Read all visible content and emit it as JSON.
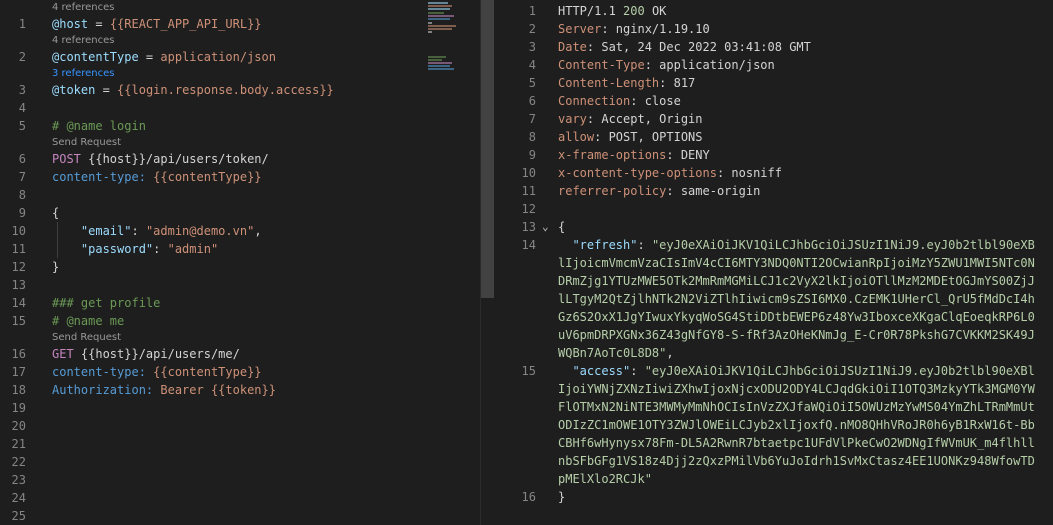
{
  "editor": {
    "lines": [
      {
        "n": "1",
        "lens": "4 references",
        "tokens": [
          [
            "var",
            "@host"
          ],
          [
            "def",
            " = "
          ],
          [
            "str",
            "{{REACT_APP_API_URL}}"
          ]
        ]
      },
      {
        "n": "2",
        "lens": "4 references",
        "tokens": [
          [
            "var",
            "@contentType"
          ],
          [
            "def",
            " = "
          ],
          [
            "str",
            "application/json"
          ]
        ]
      },
      {
        "n": "3",
        "lens": "3 references",
        "lensColor": "link",
        "tokens": [
          [
            "var",
            "@token"
          ],
          [
            "def",
            " = "
          ],
          [
            "str",
            "{{login.response.body.access}}"
          ]
        ]
      },
      {
        "n": "4",
        "tokens": []
      },
      {
        "n": "5",
        "tokens": [
          [
            "cmt",
            "# @name login"
          ]
        ]
      },
      {
        "n": "6",
        "lens": "Send Request",
        "tokens": [
          [
            "meth",
            "POST"
          ],
          [
            "def",
            " {{host}}/api/users/token/"
          ]
        ]
      },
      {
        "n": "7",
        "tokens": [
          [
            "hdr",
            "content-type: "
          ],
          [
            "str",
            "{{contentType}}"
          ]
        ]
      },
      {
        "n": "8",
        "tokens": []
      },
      {
        "n": "9",
        "tokens": [
          [
            "def",
            "{"
          ]
        ]
      },
      {
        "n": "10",
        "tokens": [
          [
            "def",
            "    "
          ],
          [
            "key",
            "\"email\""
          ],
          [
            "def",
            ": "
          ],
          [
            "str",
            "\"admin@demo.vn\""
          ],
          [
            "def",
            ","
          ]
        ]
      },
      {
        "n": "11",
        "tokens": [
          [
            "def",
            "    "
          ],
          [
            "key",
            "\"password\""
          ],
          [
            "def",
            ": "
          ],
          [
            "str",
            "\"admin\""
          ]
        ]
      },
      {
        "n": "12",
        "tokens": [
          [
            "def",
            "}"
          ]
        ]
      },
      {
        "n": "13",
        "tokens": []
      },
      {
        "n": "14",
        "tokens": [
          [
            "cmt",
            "### get profile"
          ]
        ]
      },
      {
        "n": "15",
        "tokens": [
          [
            "cmt",
            "# @name me"
          ]
        ]
      },
      {
        "n": "16",
        "lens": "Send Request",
        "tokens": [
          [
            "meth",
            "GET"
          ],
          [
            "def",
            " {{host}}/api/users/me/"
          ]
        ]
      },
      {
        "n": "17",
        "tokens": [
          [
            "hdr",
            "content-type: "
          ],
          [
            "str",
            "{{contentType}}"
          ]
        ]
      },
      {
        "n": "18",
        "tokens": [
          [
            "hdr",
            "Authorization: "
          ],
          [
            "str",
            "Bearer {{token}}"
          ]
        ]
      },
      {
        "n": "19",
        "tokens": []
      },
      {
        "n": "20",
        "tokens": []
      },
      {
        "n": "21",
        "tokens": []
      },
      {
        "n": "22",
        "tokens": []
      },
      {
        "n": "23",
        "tokens": []
      },
      {
        "n": "24",
        "tokens": []
      },
      {
        "n": "25",
        "tokens": []
      }
    ]
  },
  "response": {
    "lines": [
      {
        "n": "1",
        "tokens": [
          [
            "def",
            "HTTP/1.1 "
          ],
          [
            "num",
            "200"
          ],
          [
            "def",
            " OK"
          ]
        ]
      },
      {
        "n": "2",
        "tokens": [
          [
            "rhdr",
            "Server"
          ],
          [
            "def",
            ": nginx/1.19.10"
          ]
        ]
      },
      {
        "n": "3",
        "tokens": [
          [
            "rhdr",
            "Date"
          ],
          [
            "def",
            ": Sat, 24 Dec 2022 03:41:08 GMT"
          ]
        ]
      },
      {
        "n": "4",
        "tokens": [
          [
            "rhdr",
            "Content-Type"
          ],
          [
            "def",
            ": application/json"
          ]
        ]
      },
      {
        "n": "5",
        "tokens": [
          [
            "rhdr",
            "Content-Length"
          ],
          [
            "def",
            ": 817"
          ]
        ]
      },
      {
        "n": "6",
        "tokens": [
          [
            "rhdr",
            "Connection"
          ],
          [
            "def",
            ": close"
          ]
        ]
      },
      {
        "n": "7",
        "tokens": [
          [
            "rhdr",
            "vary"
          ],
          [
            "def",
            ": Accept, Origin"
          ]
        ]
      },
      {
        "n": "8",
        "tokens": [
          [
            "rhdr",
            "allow"
          ],
          [
            "def",
            ": POST, OPTIONS"
          ]
        ]
      },
      {
        "n": "9",
        "tokens": [
          [
            "rhdr",
            "x-frame-options"
          ],
          [
            "def",
            ": DENY"
          ]
        ]
      },
      {
        "n": "10",
        "tokens": [
          [
            "rhdr",
            "x-content-type-options"
          ],
          [
            "def",
            ": nosniff"
          ]
        ]
      },
      {
        "n": "11",
        "tokens": [
          [
            "rhdr",
            "referrer-policy"
          ],
          [
            "def",
            ": same-origin"
          ]
        ]
      },
      {
        "n": "12",
        "tokens": []
      },
      {
        "n": "13",
        "fold": true,
        "tokens": [
          [
            "def",
            "{"
          ]
        ]
      },
      {
        "n": "14",
        "wrap": [
          [
            [
              "def",
              "  "
            ],
            [
              "jkey",
              "\"refresh\""
            ],
            [
              "def",
              ": "
            ],
            [
              "jval",
              "\"eyJ0eXAiOiJKV1QiLCJhbGciOiJSUzI1NiJ9.eyJ0b2tlbl90eXB"
            ]
          ],
          [
            [
              "jval",
              "lIjoicmVmcmVzaCIsImV4cCI6MTY3NDQ0NTI2OCwianRpIjoiMzY5ZWU1MWI5NTc0N"
            ]
          ],
          [
            [
              "jval",
              "DRmZjg1YTUzMWE5OTk2MmRmMGMiLCJ1c2VyX2lkIjoiOTllMzM2MDEtOGJmYS00ZjJ"
            ]
          ],
          [
            [
              "jval",
              "lLTgyM2QtZjlhNTk2N2ViZTlhIiwicm9sZSI6MX0.CzEMK1UHerCl_QrU5fMdDcI4h"
            ]
          ],
          [
            [
              "jval",
              "Gz6S2OxX1JgYIwuxYkyqWoSG4StiDDtbEWEP6z48Yw3IboxceXKgaClqEoeqkRP6L0"
            ]
          ],
          [
            [
              "jval",
              "uV6pmDRPXGNx36Z43gNfGY8-S-fRf3AzOHeKNmJg_E-Cr0R78PkshG7CVKKM2SK49J"
            ]
          ],
          [
            [
              "jval",
              "WQBn7AoTc0L8D8\""
            ],
            [
              "def",
              ","
            ]
          ]
        ]
      },
      {
        "n": "15",
        "wrap": [
          [
            [
              "def",
              "  "
            ],
            [
              "jkey",
              "\"access\""
            ],
            [
              "def",
              ": "
            ],
            [
              "jval",
              "\"eyJ0eXAiOiJKV1QiLCJhbGciOiJSUzI1NiJ9.eyJ0b2tlbl90eXBl"
            ]
          ],
          [
            [
              "jval",
              "IjoiYWNjZXNzIiwiZXhwIjoxNjcxODU2ODY4LCJqdGkiOiI1OTQ3MzkyYTk3MGM0YW"
            ]
          ],
          [
            [
              "jval",
              "FlOTMxN2NiNTE3MWMyMmNhOCIsInVzZXJfaWQiOiI5OWUzMzYwMS04YmZhLTRmMmUt"
            ]
          ],
          [
            [
              "jval",
              "ODIzZC1mOWE1OTY3ZWJlOWEiLCJyb2xlIjoxfQ.nMO8QHhVRoJR0h6yB1RxW16t-Bb"
            ]
          ],
          [
            [
              "jval",
              "CBHf6wHynysx78Fm-DL5A2RwnR7btaetpc1UFdVlPkeCwO2WDNgIfWVmUK_m4flhll"
            ]
          ],
          [
            [
              "jval",
              "nbSFbGFg1VS18z4Djj2zQxzPMilVb6YuJoIdrh1SvMxCtasz4EE1UONKz948WfowTD"
            ]
          ],
          [
            [
              "jval",
              "pMElXlo2RCJk\""
            ]
          ]
        ]
      },
      {
        "n": "16",
        "tokens": [
          [
            "def",
            "}"
          ]
        ]
      }
    ]
  },
  "colors": {
    "link": "#3794ff"
  }
}
